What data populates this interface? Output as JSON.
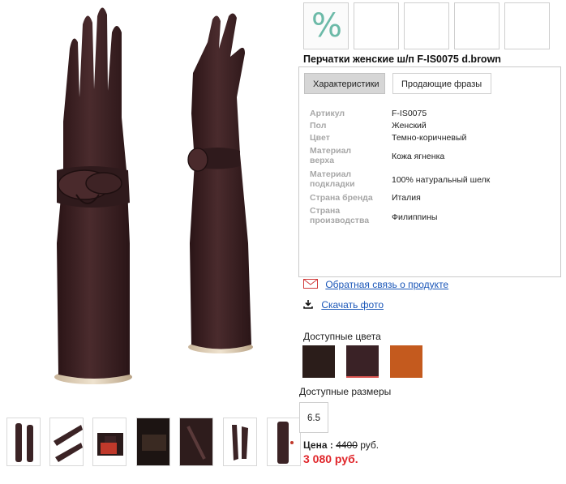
{
  "product": {
    "title": "Перчатки женские ш/п F-IS0075 d.brown",
    "discount_badge": "%"
  },
  "tabs": [
    {
      "label": "Характеристики",
      "active": true
    },
    {
      "label": "Продающие фразы",
      "active": false
    }
  ],
  "specs": [
    {
      "label": "Артикул",
      "value": "F-IS0075"
    },
    {
      "label": "Пол",
      "value": "Женский"
    },
    {
      "label": "Цвет",
      "value": "Темно-коричневый"
    },
    {
      "label": "Материал верха",
      "value": "Кожа ягненка"
    },
    {
      "label": "Материал подкладки",
      "value": "100% натуральный шелк"
    },
    {
      "label": "Страна бренда",
      "value": "Италия"
    },
    {
      "label": "Страна производства",
      "value": "Филиппины"
    }
  ],
  "links": {
    "feedback": "Обратная связь о продукте",
    "download": "Скачать фото"
  },
  "colors": {
    "label": "Доступные цвета",
    "swatches": [
      {
        "hex": "#2b1d1a",
        "selected": false
      },
      {
        "hex": "#3a2226",
        "selected": true
      },
      {
        "hex": "#c45a1e",
        "selected": false
      }
    ],
    "selected_underline": "#d9534f"
  },
  "sizes": {
    "label": "Доступные размеры",
    "options": [
      "6.5"
    ]
  },
  "price": {
    "label": "Цена :",
    "old": "4400",
    "currency": "руб.",
    "new": "3 080 руб."
  },
  "colors_theme": {
    "glove": "#3b2325",
    "discount_green": "#6cbaa8",
    "link_blue": "#1a56b8",
    "price_red": "#e0262b"
  }
}
